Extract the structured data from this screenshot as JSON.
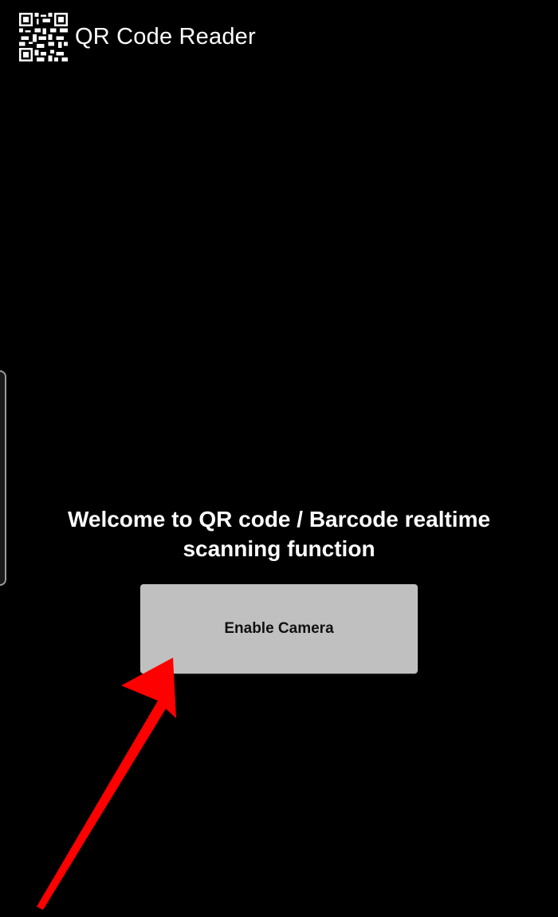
{
  "app_bar": {
    "icon": "qr-code-icon",
    "title": "QR Code Reader"
  },
  "main": {
    "welcome_text": "Welcome to QR code / Barcode realtime scanning function",
    "enable_camera_label": "Enable Camera"
  },
  "annotation": {
    "icon": "red-arrow-icon",
    "color": "#ff0000"
  },
  "colors": {
    "background": "#000000",
    "button_background": "#c0c0c0",
    "button_text": "#111111",
    "text": "#ffffff"
  }
}
